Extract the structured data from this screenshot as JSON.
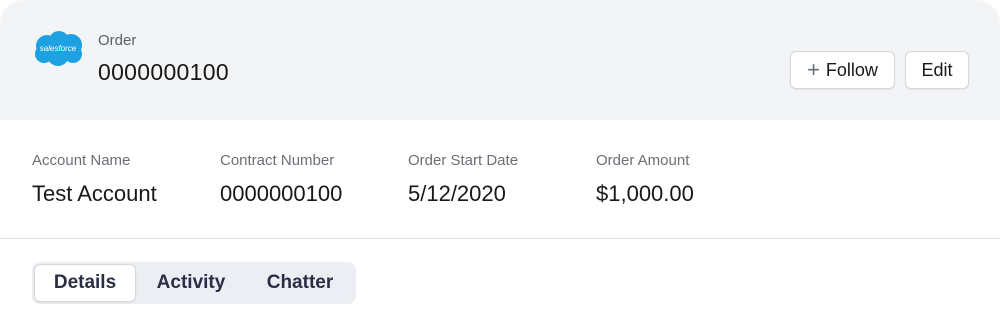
{
  "header": {
    "logo_text": "salesforce",
    "object_label": "Order",
    "record_title": "0000000100",
    "follow_label": "Follow",
    "edit_label": "Edit"
  },
  "highlights": [
    {
      "label": "Account Name",
      "value": "Test Account"
    },
    {
      "label": "Contract Number",
      "value": "0000000100"
    },
    {
      "label": "Order Start Date",
      "value": "5/12/2020"
    },
    {
      "label": "Order Amount",
      "value": "$1,000.00"
    }
  ],
  "tabs": [
    {
      "label": "Details",
      "active": true
    },
    {
      "label": "Activity",
      "active": false
    },
    {
      "label": "Chatter",
      "active": false
    }
  ],
  "colors": {
    "brand_cloud": "#1ea1e0",
    "header_bg": "#f3f4f6",
    "tab_text": "#2a2f45"
  },
  "icons": {
    "logo": "salesforce-cloud-icon",
    "follow": "plus-icon"
  }
}
